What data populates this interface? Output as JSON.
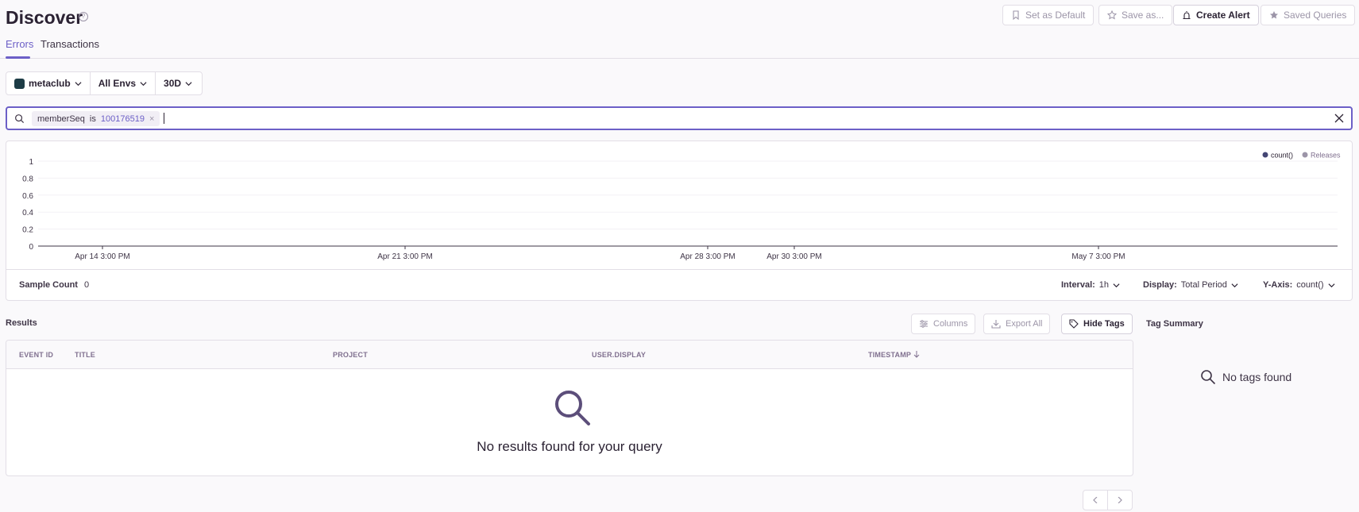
{
  "header": {
    "title": "Discover",
    "help_icon": "question-circle-icon",
    "buttons": {
      "set_default": "Set as Default",
      "save_as": "Save as...",
      "create_alert": "Create Alert",
      "saved_queries": "Saved Queries"
    },
    "tabs": {
      "errors": "Errors",
      "transactions": "Transactions"
    },
    "active_tab": "Errors",
    "accent_color": "#6c5fc7"
  },
  "filters": {
    "project": "metaclub",
    "environment": "All Envs",
    "period": "30D"
  },
  "search": {
    "token_key": "memberSeq",
    "token_op": "is",
    "token_value": "100176519",
    "token_remove": "×",
    "value": ""
  },
  "chart_data": {
    "type": "line",
    "legend": [
      "count()",
      "Releases"
    ],
    "legend_colors": {
      "count()": "#444674",
      "Releases": "#9c95a8"
    },
    "legend_position": "top-right",
    "y_ticks": [
      "0",
      "0.2",
      "0.4",
      "0.6",
      "0.8",
      "1"
    ],
    "ylim": [
      0,
      1
    ],
    "x_ticks": [
      "Apr 14 3:00 PM",
      "Apr 21 3:00 PM",
      "Apr 28 3:00 PM",
      "Apr 30 3:00 PM",
      "May 7 3:00 PM"
    ],
    "series": [
      {
        "name": "count()",
        "values": []
      }
    ],
    "grid": true
  },
  "chart_footer": {
    "sample_label": "Sample Count",
    "sample_value": "0",
    "interval_label": "Interval:",
    "interval_value": "1h",
    "display_label": "Display:",
    "display_value": "Total Period",
    "yaxis_label": "Y-Axis:",
    "yaxis_value": "count()"
  },
  "results": {
    "title": "Results",
    "buttons": {
      "columns": "Columns",
      "export": "Export All",
      "hide_tags": "Hide Tags"
    },
    "columns": [
      "EVENT ID",
      "TITLE",
      "PROJECT",
      "USER.DISPLAY",
      "TIMESTAMP"
    ],
    "empty_message": "No results found for your query"
  },
  "tags": {
    "title": "Tag Summary",
    "empty_message": "No tags found"
  }
}
